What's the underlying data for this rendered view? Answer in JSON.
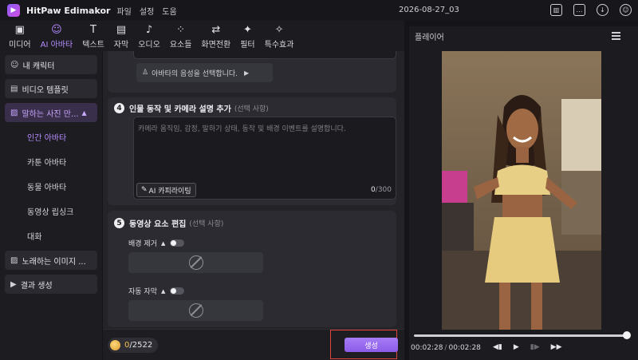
{
  "app": {
    "title": "HitPaw Edimakor",
    "menu": [
      "파일",
      "설정",
      "도움"
    ],
    "window_title": "2026-08-27_03"
  },
  "toolbar": [
    {
      "label": "미디어",
      "icon": "media-icon",
      "glyph": "▣",
      "active": false
    },
    {
      "label": "AI 아바타",
      "icon": "ai-avatar-icon",
      "glyph": "☺",
      "active": true
    },
    {
      "label": "텍스트",
      "icon": "text-icon",
      "glyph": "T",
      "active": false
    },
    {
      "label": "자막",
      "icon": "subtitle-icon",
      "glyph": "▤",
      "active": false
    },
    {
      "label": "오디오",
      "icon": "audio-icon",
      "glyph": "♪",
      "active": false
    },
    {
      "label": "요소들",
      "icon": "elements-icon",
      "glyph": "⁘",
      "active": false
    },
    {
      "label": "화면전환",
      "icon": "transition-icon",
      "glyph": "⇄",
      "active": false
    },
    {
      "label": "필터",
      "icon": "filter-icon",
      "glyph": "✦",
      "active": false
    },
    {
      "label": "특수효과",
      "icon": "effects-icon",
      "glyph": "✧",
      "active": false
    }
  ],
  "sidebar": {
    "items": [
      {
        "label": "내 캐릭터",
        "icon": "character-icon",
        "glyph": "☺"
      },
      {
        "label": "비디오 템플릿",
        "icon": "template-icon",
        "glyph": "▤"
      },
      {
        "label": "말하는 사진 만...",
        "icon": "talking-photo-icon",
        "glyph": "▨",
        "caret": "▲"
      }
    ],
    "sub_items": [
      {
        "label": "인간 아바타",
        "active": true
      },
      {
        "label": "카툰 아바타",
        "active": false
      },
      {
        "label": "동물 아바타",
        "active": false
      },
      {
        "label": "동영상 립싱크",
        "active": false
      },
      {
        "label": "대화",
        "active": false
      }
    ],
    "bottom_items": [
      {
        "label": "노래하는 이미지 ...",
        "icon": "singing-image-icon",
        "glyph": "▨"
      },
      {
        "label": "결과 생성",
        "icon": "result-icon",
        "glyph": "▶"
      }
    ]
  },
  "main": {
    "voice_select": "아바타의 음성을 선택합니다.",
    "voice_arrow": "▶",
    "section4": {
      "num": "4",
      "title": "인물 동작 및 카메라 설명 추가",
      "optional": "(선택 사항)",
      "placeholder": "카메라 움직임, 감정, 말하기 상태, 동작 및 배경 이벤트를 설명합니다.",
      "ai_button": "AI 카피라이팅",
      "count": "0",
      "max": "/300"
    },
    "section5": {
      "num": "5",
      "title": "동영상 요소 편집",
      "optional": "(선택 사항)",
      "bg_remove": "배경 제거",
      "auto_caption": "자동 자막",
      "caret": "▲"
    }
  },
  "footer": {
    "credits_used": "0",
    "credits_total": "/2522",
    "generate": "생성"
  },
  "player": {
    "title": "플레이어",
    "current_time": "00:02:28",
    "separator": "/",
    "total_time": "00:02:28",
    "progress": 1.0,
    "controls": [
      "◀▮",
      "▶",
      "▮▶",
      "▶▶"
    ]
  }
}
